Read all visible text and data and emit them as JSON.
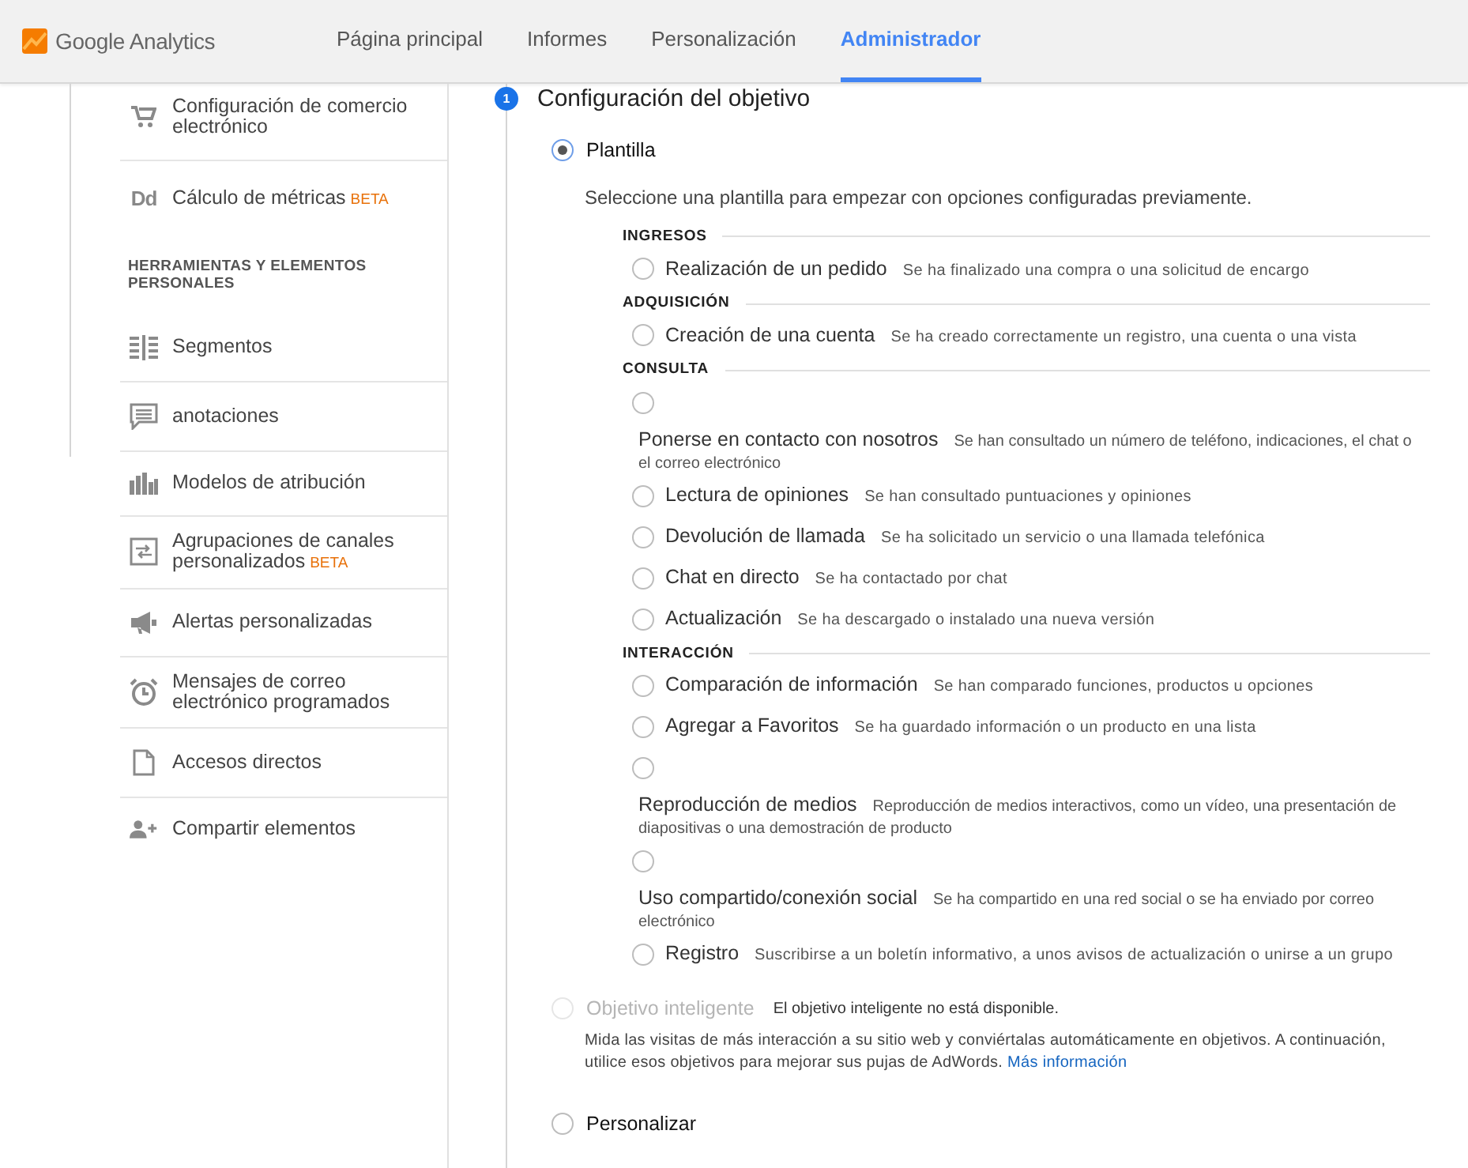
{
  "header": {
    "logo": "Google Analytics",
    "nav": [
      {
        "label": "Página principal",
        "selected": false
      },
      {
        "label": "Informes",
        "selected": false
      },
      {
        "label": "Personalización",
        "selected": false
      },
      {
        "label": "Administrador",
        "selected": true
      }
    ]
  },
  "sidebar": {
    "items_top": [
      {
        "label": "Configuración de comercio electrónico"
      },
      {
        "label": "Cálculo de métricas",
        "badge": "BETA",
        "icon_text": "Dd"
      }
    ],
    "section": "HERRAMIENTAS Y ELEMENTOS PERSONALES",
    "items": [
      {
        "label": "Segmentos"
      },
      {
        "label": "anotaciones"
      },
      {
        "label": "Modelos de atribución"
      },
      {
        "label": "Agrupaciones de canales personalizados",
        "badge": "BETA"
      },
      {
        "label": "Alertas personalizadas"
      },
      {
        "label": "Mensajes de correo electrónico programados"
      },
      {
        "label": "Accesos directos"
      },
      {
        "label": "Compartir elementos"
      }
    ]
  },
  "step": {
    "number": "1",
    "title": "Configuración del objetivo"
  },
  "template": {
    "label": "Plantilla",
    "selected": true,
    "hint": "Seleccione una plantilla para empezar con opciones configuradas previamente.",
    "categories": [
      {
        "title": "INGRESOS",
        "items": [
          {
            "kind": "inline",
            "name": "Realización de un pedido",
            "description": "Se ha finalizado una compra o una solicitud de encargo",
            "selected": false
          }
        ]
      },
      {
        "title": "ADQUISICIÓN",
        "items": [
          {
            "kind": "inline",
            "name": "Creación de una cuenta",
            "description": "Se ha creado correctamente un registro, una cuenta o una vista",
            "selected": false
          }
        ]
      },
      {
        "title": "CONSULTA",
        "items": [
          {
            "kind": "stacked",
            "name": "Ponerse en contacto con nosotros",
            "description": "Se han consultado un número de teléfono, indicaciones, el chat o el correo electrónico",
            "selected": false
          },
          {
            "kind": "inline",
            "name": "Lectura de opiniones",
            "description": "Se han consultado puntuaciones y opiniones",
            "selected": false
          },
          {
            "kind": "inline",
            "name": "Devolución de llamada",
            "description": "Se ha solicitado un servicio o una llamada telefónica",
            "selected": false
          },
          {
            "kind": "inline",
            "name": "Chat en directo",
            "description": "Se ha contactado por chat",
            "selected": false
          },
          {
            "kind": "inline",
            "name": "Actualización",
            "description": "Se ha descargado o instalado una nueva versión",
            "selected": false
          }
        ]
      },
      {
        "title": "INTERACCIÓN",
        "items": [
          {
            "kind": "inline",
            "name": "Comparación de información",
            "description": "Se han comparado funciones, productos u opciones",
            "selected": false
          },
          {
            "kind": "inline",
            "name": "Agregar a Favoritos",
            "description": "Se ha guardado información o un producto en una lista",
            "selected": false
          },
          {
            "kind": "stacked",
            "name": "Reproducción de medios",
            "description": "Reproducción de medios interactivos, como un vídeo, una presentación de diapositivas o una demostración de producto",
            "selected": false
          },
          {
            "kind": "stacked",
            "name": "Uso compartido/conexión social",
            "description": "Se ha compartido en una red social o se ha enviado por correo electrónico",
            "selected": false
          },
          {
            "kind": "inline",
            "name": "Registro",
            "description": "Suscribirse a un boletín informativo, a unos avisos de actualización o unirse a un grupo",
            "selected": false
          }
        ]
      }
    ]
  },
  "smart_goal": {
    "label": "Objetivo inteligente",
    "disabled": true,
    "selected": false,
    "status": "El objetivo inteligente no está disponible.",
    "description": "Mida las visitas de más interacción a su sitio web y conviértalas automáticamente en objetivos. A continuación, utilice esos objetivos para mejorar sus pujas de AdWords.",
    "link": "Más información"
  },
  "custom": {
    "label": "Personalizar",
    "selected": false
  }
}
